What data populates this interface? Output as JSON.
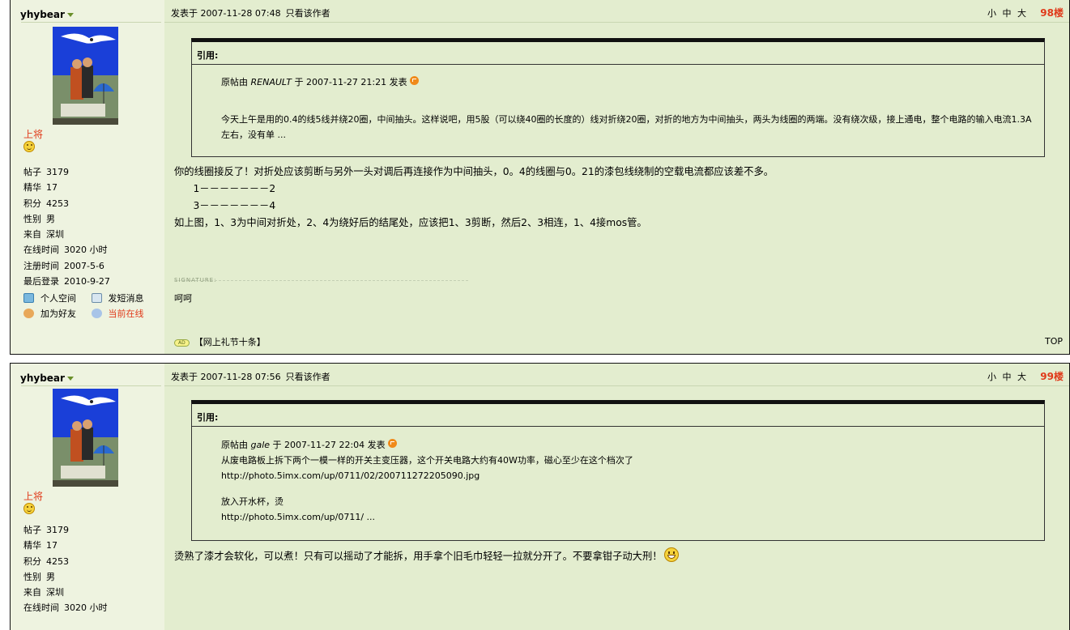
{
  "posts": [
    {
      "user": {
        "name": "yhybear",
        "rank": "上将",
        "stats": [
          {
            "k": "帖子",
            "v": "3179"
          },
          {
            "k": "精华",
            "v": "17"
          },
          {
            "k": "积分",
            "v": "4253"
          },
          {
            "k": "性别",
            "v": "男"
          },
          {
            "k": "来自",
            "v": "深圳"
          },
          {
            "k": "在线时间",
            "v": "3020 小时"
          },
          {
            "k": "注册时间",
            "v": "2007-5-6"
          },
          {
            "k": "最后登录",
            "v": "2010-9-27"
          }
        ],
        "links": {
          "space": "个人空间",
          "pm": "发短消息",
          "addfriend": "加为好友",
          "online": "当前在线"
        }
      },
      "posted": "发表于 2007-11-28 07:48",
      "only_author": "只看该作者",
      "font_sizes": "小 中 大",
      "floor": "98楼",
      "quote": {
        "title": "引用:",
        "origin_prefix": "原帖由",
        "origin_user": "RENAULT",
        "origin_time": "于 2007-11-27 21:21 发表",
        "lines": [
          "",
          "今天上午是用的0.4的线5线并绕20圈，中间抽头。这样说吧，用5股（可以绕40圈的长度的）线对折绕20圈，对折的地方为中间抽头，两头为线圈的两端。没有绕次级，接上通电，整个电路的输入电流1.3A左右，没有单 ..."
        ]
      },
      "body": [
        "你的线圈接反了！对折处应该剪断与另外一头对调后再连接作为中间抽头，0。4的线圈与0。21的漆包线绕制的空载电流都应该差不多。",
        "      1－－－－－－－2",
        "      3－－－－－－－4",
        "如上图，1、3为中间对折处，2、4为绕好后的结尾处，应该把1、3剪断，然后2、3相连，1、4接mos管。"
      ],
      "signature_label": "SIGNATURE:",
      "signature": "呵呵",
      "ad_badge": "AD",
      "ad_text": "【网上礼节十条】",
      "top": "TOP"
    },
    {
      "user": {
        "name": "yhybear",
        "rank": "上将",
        "stats": [
          {
            "k": "帖子",
            "v": "3179"
          },
          {
            "k": "精华",
            "v": "17"
          },
          {
            "k": "积分",
            "v": "4253"
          },
          {
            "k": "性别",
            "v": "男"
          },
          {
            "k": "来自",
            "v": "深圳"
          },
          {
            "k": "在线时间",
            "v": "3020 小时"
          }
        ]
      },
      "posted": "发表于 2007-11-28 07:56",
      "only_author": "只看该作者",
      "font_sizes": "小 中 大",
      "floor": "99楼",
      "quote": {
        "title": "引用:",
        "origin_prefix": "原帖由",
        "origin_user": "gale",
        "origin_time": "于 2007-11-27 22:04 发表",
        "lines": [
          "从废电路板上拆下两个一模一样的开关主变压器，这个开关电路大约有40W功率，磁心至少在这个档次了",
          "http://photo.5imx.com/up/0711/02/200711272205090.jpg",
          "",
          "放入开水杯，烫",
          "http://photo.5imx.com/up/0711/ ..."
        ]
      },
      "body": [
        "烫熟了漆才会软化，可以煮！只有可以摇动了才能拆，用手拿个旧毛巾轻轻一拉就分开了。不要拿钳子动大刑！"
      ]
    }
  ],
  "colors": {
    "rank": "#e03a1a",
    "floor": "#e03a1a",
    "post_bg": "#e3edcf",
    "side_bg": "#eef3e0"
  }
}
